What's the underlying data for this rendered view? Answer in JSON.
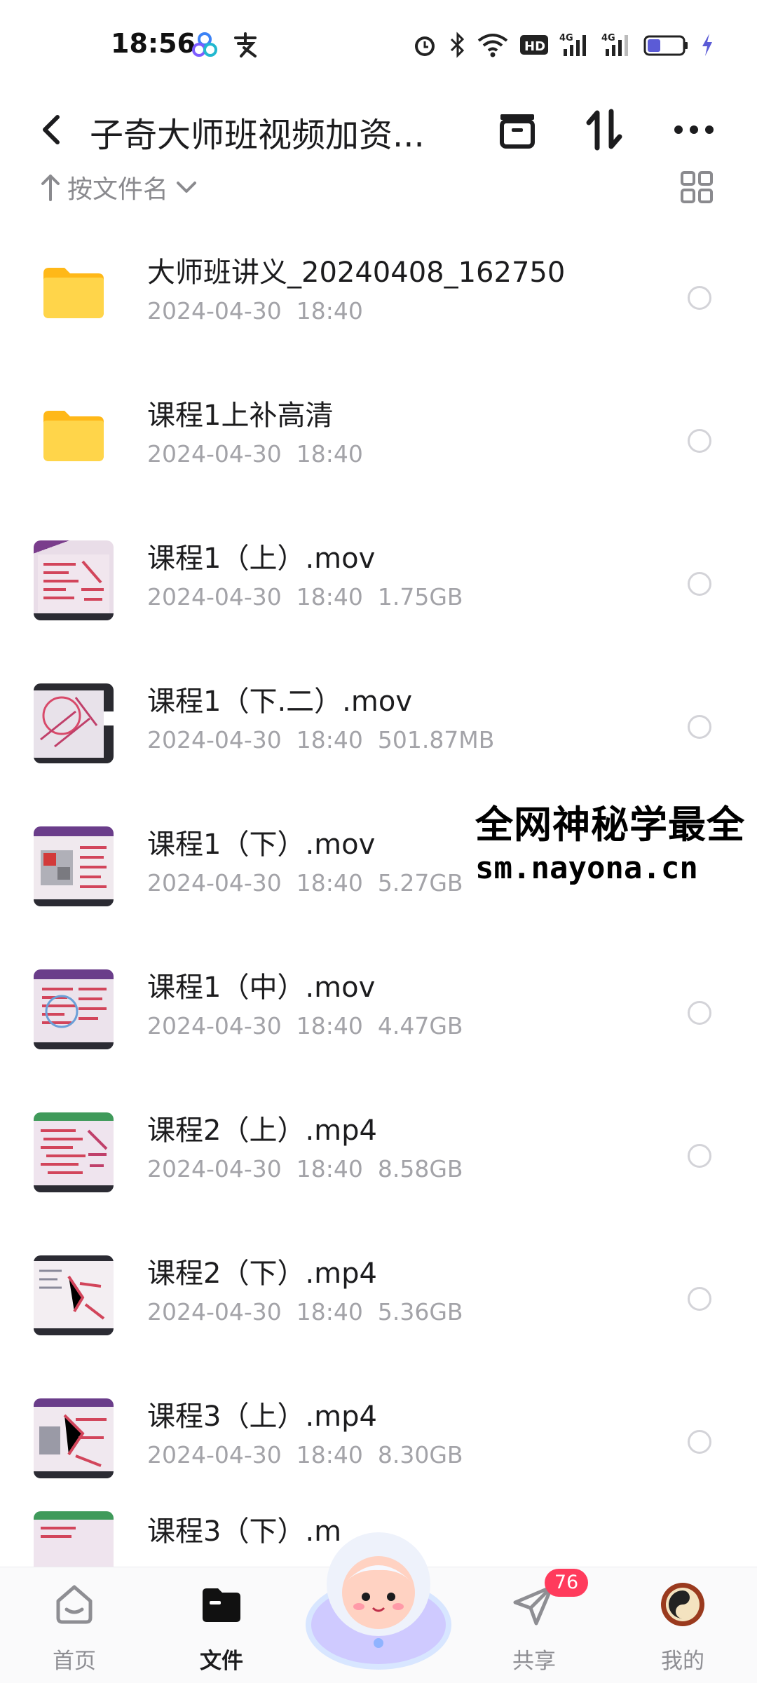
{
  "status_bar": {
    "time": "18:56"
  },
  "header": {
    "title": "子奇大师班视频加资..."
  },
  "sort_bar": {
    "label": "按文件名"
  },
  "files": [
    {
      "name": "大师班讲义_20240408_162750",
      "meta": "2024-04-30  18:40",
      "kind": "folder"
    },
    {
      "name": "课程1上补高清",
      "meta": "2024-04-30  18:40",
      "kind": "folder"
    },
    {
      "name": "课程1（上）.mov",
      "meta": "2024-04-30  18:40  1.75GB",
      "kind": "video"
    },
    {
      "name": "课程1（下.二）.mov",
      "meta": "2024-04-30  18:40  501.87MB",
      "kind": "video"
    },
    {
      "name": "课程1（下）.mov",
      "meta": "2024-04-30  18:40  5.27GB",
      "kind": "video"
    },
    {
      "name": "课程1（中）.mov",
      "meta": "2024-04-30  18:40  4.47GB",
      "kind": "video"
    },
    {
      "name": "课程2（上）.mp4",
      "meta": "2024-04-30  18:40  8.58GB",
      "kind": "video"
    },
    {
      "name": "课程2（下）.mp4",
      "meta": "2024-04-30  18:40  5.36GB",
      "kind": "video"
    },
    {
      "name": "课程3（上）.mp4",
      "meta": "2024-04-30  18:40  8.30GB",
      "kind": "video"
    },
    {
      "name": "课程3（下）.m",
      "meta": "",
      "kind": "video"
    }
  ],
  "watermark": {
    "line1": "全网神秘学最全",
    "line2": "sm.nayona.cn"
  },
  "bottom_nav": {
    "home": "首页",
    "files": "文件",
    "share": "共享",
    "share_badge": "76",
    "mine": "我的"
  },
  "colors": {
    "accent_badge": "#ff3b5c",
    "folder": "#ffc928",
    "battery": "#5b5bd6"
  }
}
